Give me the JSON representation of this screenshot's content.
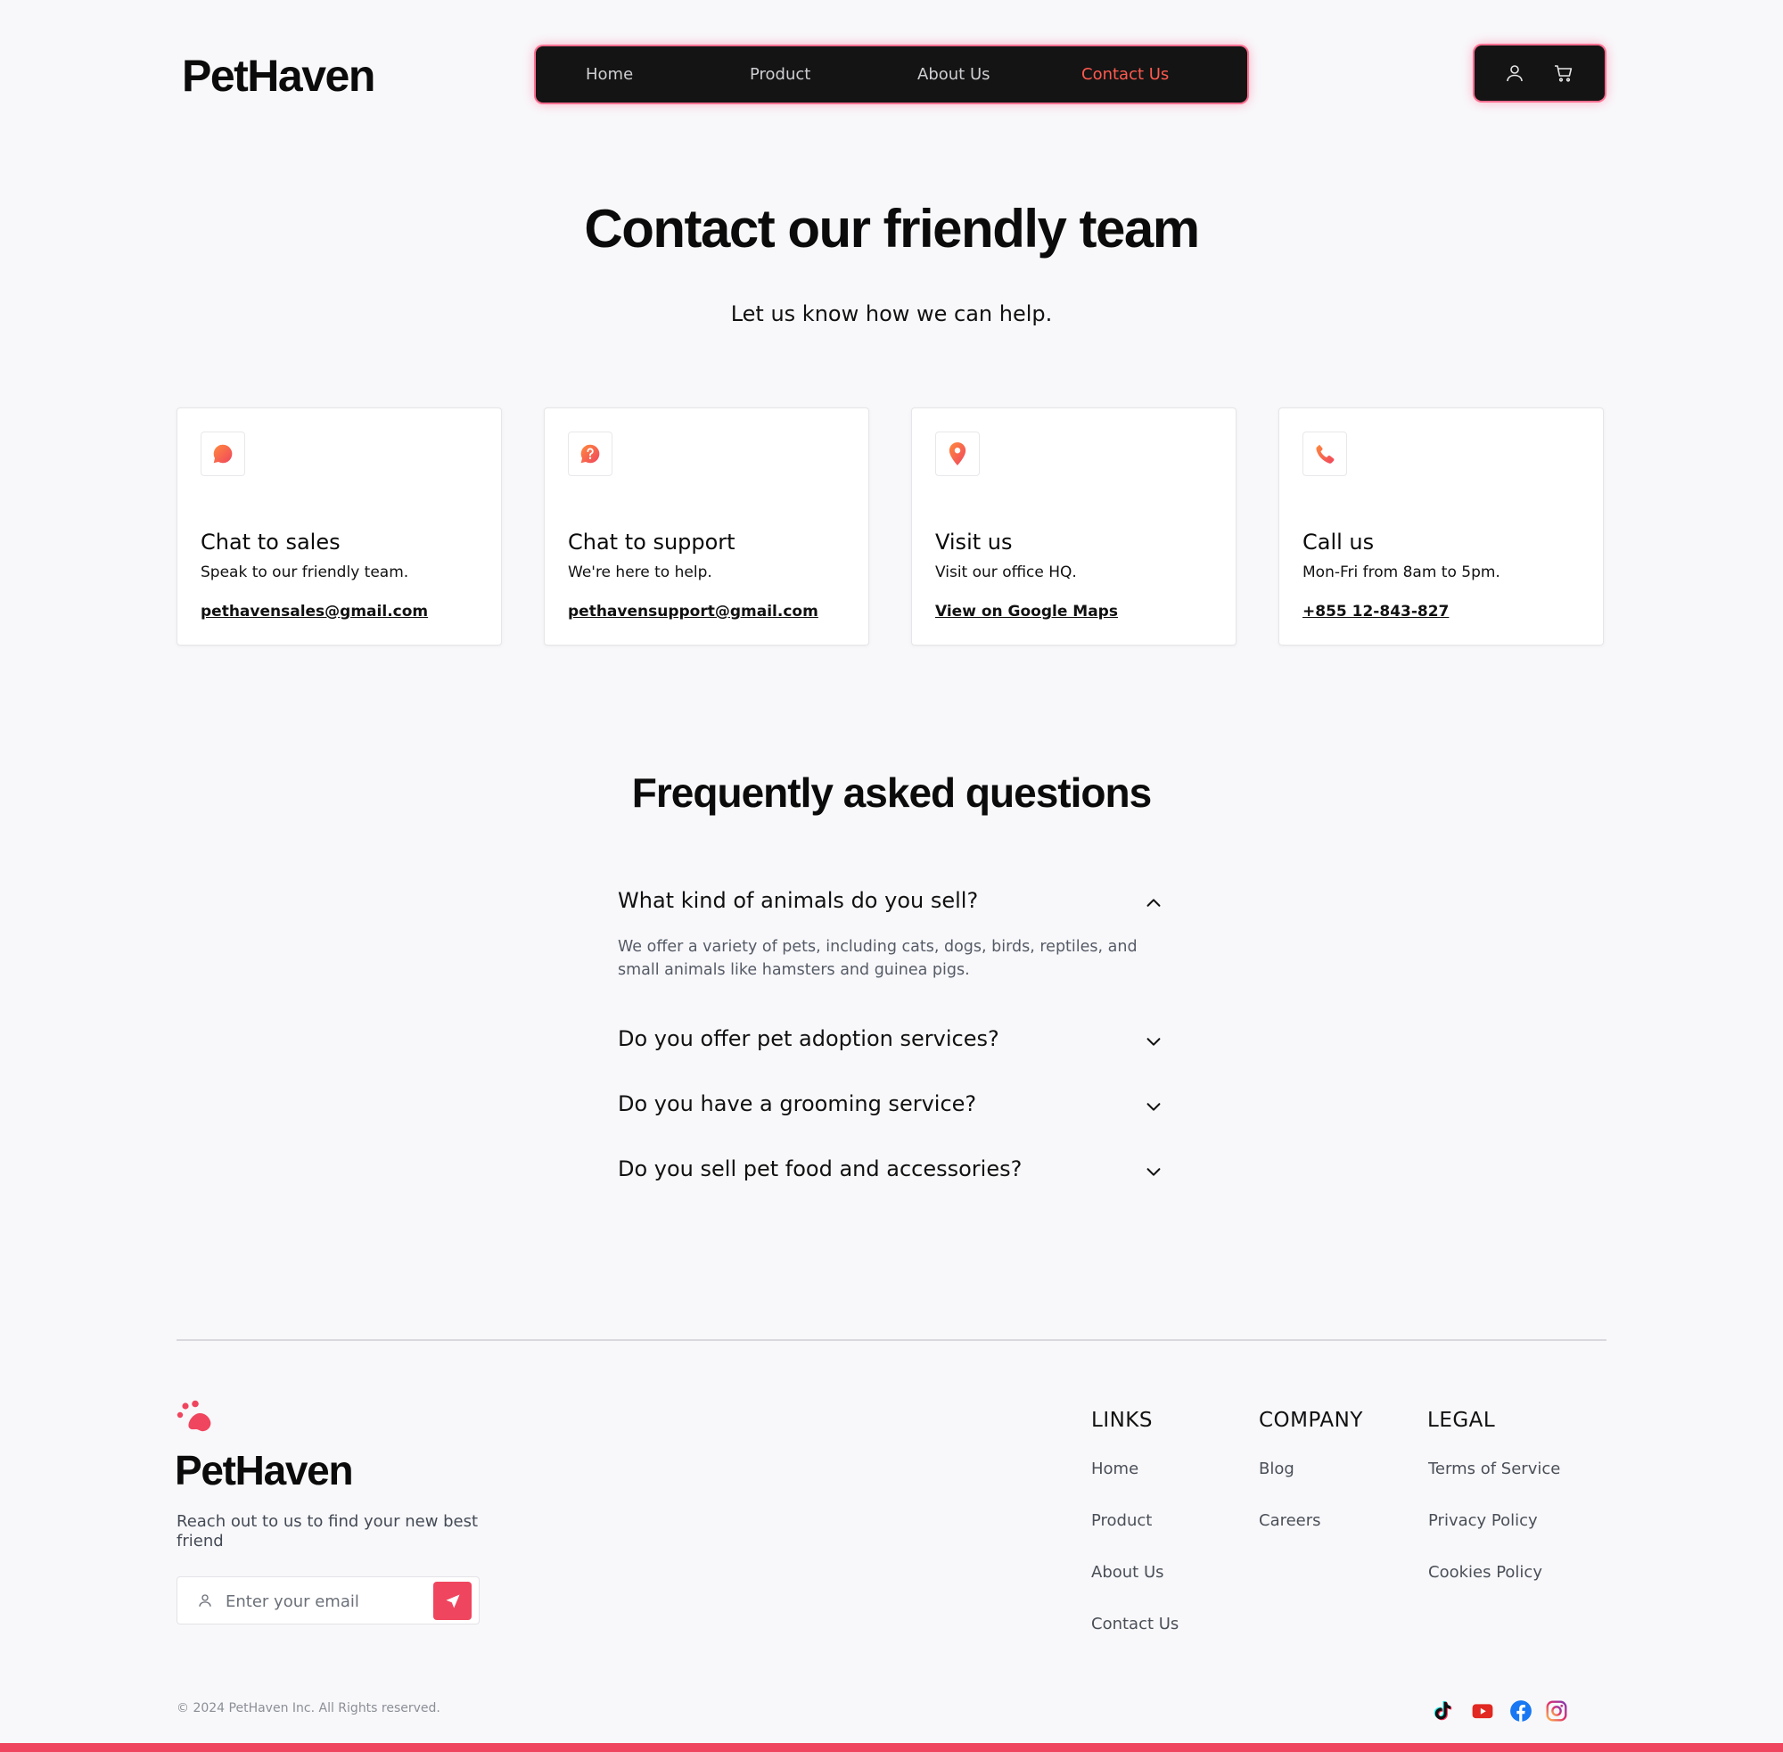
{
  "brand": {
    "name": "PetHaven"
  },
  "nav": {
    "items": [
      {
        "label": "Home"
      },
      {
        "label": "Product"
      },
      {
        "label": "About Us"
      },
      {
        "label": "Contact Us",
        "active": true
      }
    ],
    "icons": [
      "user-icon",
      "cart-icon"
    ]
  },
  "hero": {
    "title": "Contact our friendly team",
    "subtitle": "Let us know how we can help."
  },
  "cards": [
    {
      "icon": "chat-bubble-icon",
      "title": "Chat to sales",
      "desc": "Speak to our friendly team.",
      "link": "pethavensales@gmail.com"
    },
    {
      "icon": "help-chat-icon",
      "title": "Chat to support",
      "desc": "We're here to help.",
      "link": "pethavensupport@gmail.com"
    },
    {
      "icon": "map-pin-icon",
      "title": "Visit us",
      "desc": "Visit our office HQ.",
      "link": "View on Google Maps"
    },
    {
      "icon": "phone-icon",
      "title": "Call us",
      "desc": "Mon-Fri from 8am to 5pm.",
      "link": "+855 12-843-827"
    }
  ],
  "faq": {
    "title": "Frequently asked questions",
    "items": [
      {
        "question": "What kind of animals do you sell?",
        "expanded": true,
        "answer": "We offer a variety of pets, including cats, dogs, birds, reptiles, and small animals like hamsters and guinea pigs."
      },
      {
        "question": "Do you offer pet adoption services?",
        "expanded": false
      },
      {
        "question": "Do you have a grooming service?",
        "expanded": false
      },
      {
        "question": "Do you sell pet food and accessories?",
        "expanded": false
      }
    ]
  },
  "footer": {
    "brand": "PetHaven",
    "tagline": "Reach out to us to find your new best friend",
    "email_placeholder": "Enter your email",
    "columns": [
      {
        "heading": "LINKS",
        "links": [
          "Home",
          "Product",
          "About Us",
          "Contact Us"
        ]
      },
      {
        "heading": "COMPANY",
        "links": [
          "Blog",
          "Careers"
        ]
      },
      {
        "heading": "LEGAL",
        "links": [
          "Terms of Service",
          "Privacy Policy",
          "Cookies Policy"
        ]
      }
    ],
    "copyright": "© 2024 PetHaven Inc. All Rights reserved.",
    "social": [
      "tiktok-icon",
      "youtube-icon",
      "facebook-icon",
      "instagram-icon"
    ]
  },
  "colors": {
    "accent": "#f0455e",
    "active_nav": "#ff5a4f",
    "nav_bg": "#141414",
    "page_bg": "#f8f8fa"
  }
}
